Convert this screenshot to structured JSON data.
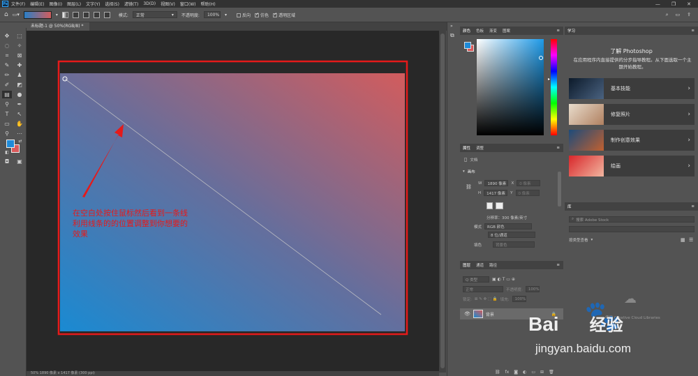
{
  "menubar": {
    "logo": "Ps",
    "items": [
      "文件(F)",
      "编辑(E)",
      "图像(I)",
      "图层(L)",
      "文字(Y)",
      "选择(S)",
      "滤镜(T)",
      "3D(D)",
      "视图(V)",
      "窗口(W)",
      "帮助(H)"
    ],
    "window_controls": [
      "—",
      "❐",
      "✕"
    ]
  },
  "options": {
    "mode_label": "模式:",
    "mode_value": "正常",
    "opacity_label": "不透明度:",
    "opacity_value": "100%",
    "reverse_label": "反向",
    "dither_label": "仿色",
    "transparency_label": "透明区域"
  },
  "document": {
    "tab_title": "未标题-1 @ 50%(RGB/8) *",
    "annotation_lines": [
      "在空白处按住鼠标然后看到一条线",
      "利用线条的的位置调整到你想要的",
      "效果"
    ],
    "status": "50%     1890 像素 x 1417 像素 (300 ppi)"
  },
  "colors": {
    "foreground": "#1e8ad8",
    "background": "#d9595a",
    "gradient_start": "#1a8ad2",
    "gradient_end": "#d25c5d",
    "annotation": "#e51a1a"
  },
  "color_panel": {
    "tabs": [
      "颜色",
      "色板",
      "渐变",
      "图案"
    ]
  },
  "properties": {
    "tabs": [
      "属性",
      "调整"
    ],
    "doc_label": "文档",
    "section": "画布",
    "w_label": "W",
    "w_value": "1890 像素",
    "x_label": "X",
    "x_placeholder": "0 像素",
    "h_label": "H",
    "h_value": "1417 像素",
    "y_label": "Y",
    "y_placeholder": "0 像素",
    "resolution": "分辨率：300 像素/英寸",
    "mode_label": "模式",
    "mode_value": "RGB 颜色",
    "depth_value": "8 位/通道",
    "fill_label": "填色",
    "fill_value": "背景色"
  },
  "layers": {
    "tabs": [
      "图层",
      "通道",
      "路径"
    ],
    "filter_placeholder": "Q 类型",
    "blend_mode": "正常",
    "opacity_label": "不透明度:",
    "opacity_value": "100%",
    "lock_label": "锁定:",
    "fill_label": "填充:",
    "fill_value": "100%",
    "layer_name": "背景"
  },
  "learn": {
    "tab": "学习",
    "title": "了解 Photoshop",
    "description": "在应用程序内直接提供的分步指导教程。从下面选取一个主题开始教程。",
    "cards": [
      "基本技能",
      "修复照片",
      "制作创意效果",
      "绘画"
    ]
  },
  "libraries": {
    "tab": "库",
    "search_placeholder": "搜索 Adobe Stock",
    "view_label": "按类型查看",
    "empty_text": "使用 Creative Cloud Libraries"
  },
  "watermark": {
    "brand_prefix": "Bai",
    "brand_suffix": "经验",
    "url": "jingyan.baidu.com"
  }
}
